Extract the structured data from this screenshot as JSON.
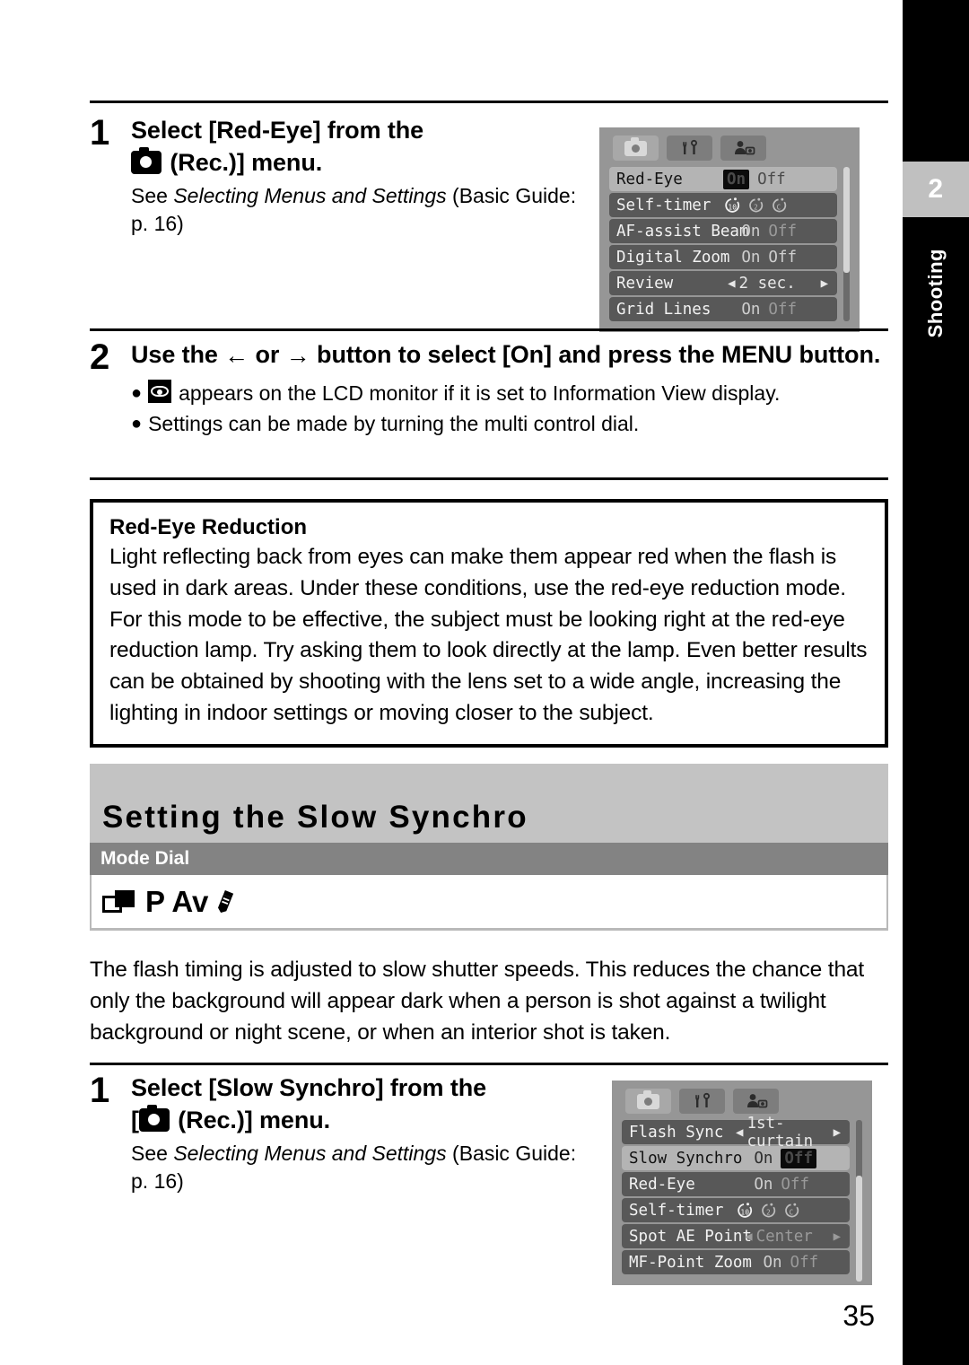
{
  "sidebar": {
    "chapter_number": "2",
    "chapter_label": "Shooting"
  },
  "page_number": "35",
  "step1": {
    "number": "1",
    "title_line1": "Select [Red-Eye] from the",
    "title_icon": "camera-icon",
    "title_line2_suffix": " (Rec.)] menu.",
    "note_prefix": "See ",
    "note_italic": "Selecting Menus and Settings",
    "note_suffix": " (Basic Guide: p. 16)"
  },
  "step2": {
    "number": "2",
    "title_part1": "Use the ",
    "arrow_left": "←",
    "title_part2": " or ",
    "arrow_right": "→",
    "title_part3": " button to select [On] and press the MENU button.",
    "bullets": [
      {
        "icon": "eye-icon",
        "text": "appears on the LCD monitor if it is set to Information View display."
      },
      {
        "icon": "",
        "text": "Settings can be made by turning the multi control dial."
      }
    ]
  },
  "info_box": {
    "title": "Red-Eye Reduction",
    "text": "Light reflecting back from eyes can make them appear red when the flash is used in dark areas. Under these conditions, use the red-eye reduction mode. For this mode to be effective, the subject must be looking right at the red-eye reduction lamp. Try asking them to look directly at the lamp. Even better results can be obtained by shooting with the lens set to a wide angle, increasing the lighting in indoor settings or moving closer to the subject."
  },
  "section": {
    "heading": "Setting the Slow Synchro",
    "mode_dial_label": "Mode Dial",
    "mode_dial_modes": "P Av",
    "body": "The flash timing is adjusted to slow shutter speeds. This reduces the chance that only the background will appear dark when a person is shot against a twilight background or night scene, or when an interior shot is taken."
  },
  "step3": {
    "number": "1",
    "title_prefix": "Select [Slow Synchro] from the",
    "title_line2_open": "[",
    "title_line2_suffix": " (Rec.)] menu.",
    "note_prefix": "See ",
    "note_italic": "Selecting Menus and Settings",
    "note_suffix": " (Basic Guide: p. 16)"
  },
  "lcd_top": {
    "tabs": [
      {
        "name": "rec-tab",
        "icon": "camera-icon",
        "active": true
      },
      {
        "name": "setup-tab",
        "icon": "tools-icon",
        "active": false
      },
      {
        "name": "my-camera-tab",
        "icon": "my-camera-icon",
        "active": false
      }
    ],
    "rows": [
      {
        "label": "Red-Eye",
        "selected": true,
        "type": "onoff",
        "values": [
          "On",
          "Off"
        ],
        "active_index": 0
      },
      {
        "label": "Self-timer",
        "selected": false,
        "type": "timer",
        "values": [
          "10",
          "2",
          "C"
        ],
        "active_index": 0
      },
      {
        "label": "AF-assist Beam",
        "selected": false,
        "type": "onoff",
        "values": [
          "On",
          "Off"
        ],
        "active_index": -1
      },
      {
        "label": "Digital Zoom",
        "selected": false,
        "type": "onoff",
        "values": [
          "On",
          "Off"
        ],
        "active_index": -1
      },
      {
        "label": "Review",
        "selected": false,
        "type": "spin",
        "values": [
          "2 sec."
        ],
        "active_index": -1
      },
      {
        "label": "Grid Lines",
        "selected": false,
        "type": "onoff",
        "values": [
          "On",
          "Off"
        ],
        "active_index": -1
      }
    ]
  },
  "lcd_bottom": {
    "tabs": [
      {
        "name": "rec-tab",
        "icon": "camera-icon",
        "active": true
      },
      {
        "name": "setup-tab",
        "icon": "tools-icon",
        "active": false
      },
      {
        "name": "my-camera-tab",
        "icon": "my-camera-icon",
        "active": false
      }
    ],
    "rows": [
      {
        "label": "Flash Sync",
        "selected": false,
        "type": "spin",
        "values": [
          "1st-curtain"
        ],
        "active_index": -1
      },
      {
        "label": "Slow Synchro",
        "selected": true,
        "type": "onoff",
        "values": [
          "On",
          "Off"
        ],
        "active_index": 1
      },
      {
        "label": "Red-Eye",
        "selected": false,
        "type": "onoff",
        "values": [
          "On",
          "Off"
        ],
        "active_index": -1
      },
      {
        "label": "Self-timer",
        "selected": false,
        "type": "timer",
        "values": [
          "10",
          "2",
          "C"
        ],
        "active_index": 0
      },
      {
        "label": "Spot AE Point",
        "selected": false,
        "type": "spin-dim",
        "values": [
          "Center"
        ],
        "active_index": -1
      },
      {
        "label": "MF-Point Zoom",
        "selected": false,
        "type": "onoff",
        "values": [
          "On",
          "Off"
        ],
        "active_index": -1
      }
    ]
  },
  "colors": {
    "sidebar_bg": "#000000",
    "sidebar_num_bg": "#c0c0c0",
    "section_heading_bg": "#c3c3c3",
    "mode_dial_bg": "#838383",
    "lcd_bg": "#969696",
    "lcd_row_bg": "#585858",
    "lcd_row_selected_bg": "#b4b4b4"
  }
}
